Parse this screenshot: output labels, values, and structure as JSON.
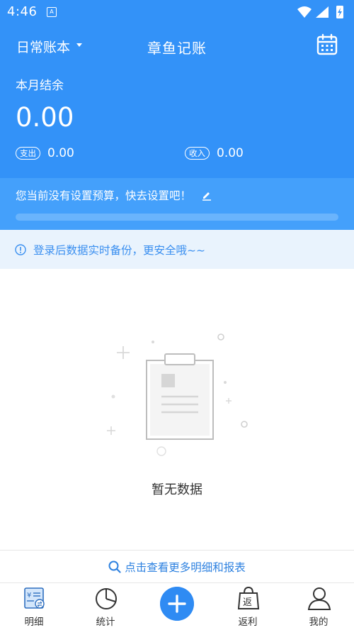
{
  "status_bar": {
    "time": "4:46",
    "app_icon": "A"
  },
  "header": {
    "book_selector": "日常账本",
    "title": "章鱼记账",
    "month_label": "本月结余",
    "balance": "0.00",
    "expense_label": "支出",
    "expense_value": "0.00",
    "income_label": "收入",
    "income_value": "0.00"
  },
  "budget": {
    "text": "您当前没有设置预算，快去设置吧！",
    "progress": 0
  },
  "notice": {
    "text": "登录后数据实时备份，更安全哦~~"
  },
  "empty_state": {
    "text": "暂无数据"
  },
  "more_link": {
    "text": "点击查看更多明细和报表"
  },
  "tabs": [
    {
      "label": "明细",
      "icon": "detail-icon"
    },
    {
      "label": "统计",
      "icon": "pie-chart-icon"
    },
    {
      "label": "",
      "icon": "add-icon"
    },
    {
      "label": "返利",
      "icon": "rebate-bag-icon"
    },
    {
      "label": "我的",
      "icon": "user-icon"
    }
  ],
  "colors": {
    "primary": "#3392f8",
    "budget_bg": "#44a0fb",
    "notice_bg": "#e9f3fd",
    "link": "#2f82e0"
  }
}
